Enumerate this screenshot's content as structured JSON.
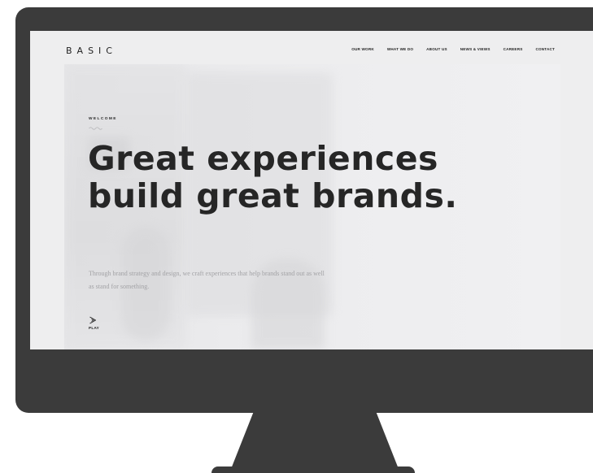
{
  "site": {
    "brand": "BASIC"
  },
  "nav": {
    "items": [
      {
        "label": "OUR WORK"
      },
      {
        "label": "WHAT WE DO"
      },
      {
        "label": "ABOUT US"
      },
      {
        "label": "NEWS & VIEWS"
      },
      {
        "label": "CAREERS"
      },
      {
        "label": "CONTACT"
      }
    ]
  },
  "hero": {
    "eyebrow": "WELCOME",
    "headline_line1": "Great experiences",
    "headline_line2": "build great brands.",
    "subtext": "Through brand strategy and design, we craft experiences that help brands stand out as well as stand for something.",
    "play_label": "PLAY"
  },
  "icons": {
    "play": "play-icon",
    "squiggle": "wave-squiggle-icon"
  },
  "colors": {
    "monitor_frame": "#3b3b3b",
    "screen_bg": "#eeeeef",
    "headline": "#262626",
    "subtext": "#a3a3a6"
  }
}
